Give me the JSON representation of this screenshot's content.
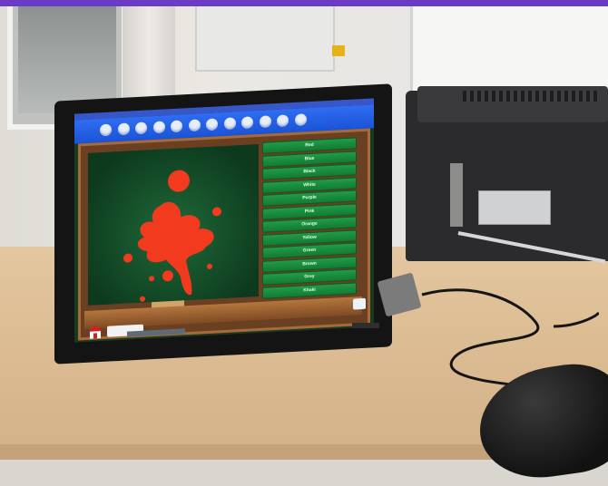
{
  "scene": {
    "colors": {
      "splat": "#f23a1f",
      "chalkboard": "#0d3a1d",
      "wood": "#a46b3b",
      "ribbon": "#2f6df2",
      "button": "#1f9d48",
      "desk": "#ddbd94"
    }
  },
  "game": {
    "progress_pips": 12,
    "colors": [
      "Red",
      "Blue",
      "Black",
      "White",
      "Purple",
      "Pink",
      "Orange",
      "Yellow",
      "Green",
      "Brown",
      "Grey",
      "Khaki"
    ]
  },
  "icons": {
    "home": "home-icon",
    "back": "back-icon",
    "clip": "clip-icon",
    "splat": "paint-splat-icon"
  }
}
